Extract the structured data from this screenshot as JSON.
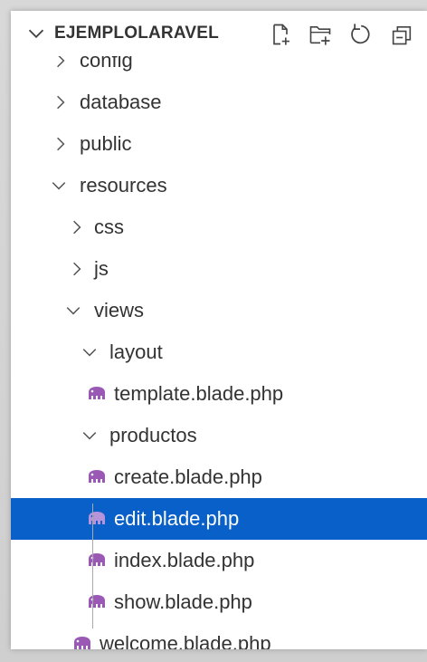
{
  "explorer": {
    "title": "EJEMPLOLARAVEL",
    "actions": {
      "new_file_icon": "new-file-icon",
      "new_folder_icon": "new-folder-icon",
      "refresh_icon": "refresh-icon",
      "collapse_icon": "collapse-all-icon"
    },
    "items": [
      {
        "label": "config",
        "type": "folder",
        "expanded": false,
        "depth": 0
      },
      {
        "label": "database",
        "type": "folder",
        "expanded": false,
        "depth": 0
      },
      {
        "label": "public",
        "type": "folder",
        "expanded": false,
        "depth": 0
      },
      {
        "label": "resources",
        "type": "folder",
        "expanded": true,
        "depth": 0
      },
      {
        "label": "css",
        "type": "folder",
        "expanded": false,
        "depth": 1
      },
      {
        "label": "js",
        "type": "folder",
        "expanded": false,
        "depth": 1
      },
      {
        "label": "views",
        "type": "folder",
        "expanded": true,
        "depth": 1
      },
      {
        "label": "layout",
        "type": "folder",
        "expanded": true,
        "depth": 2
      },
      {
        "label": "template.blade.php",
        "type": "file",
        "depth": 3
      },
      {
        "label": "productos",
        "type": "folder",
        "expanded": true,
        "depth": 2
      },
      {
        "label": "create.blade.php",
        "type": "file",
        "depth": 3
      },
      {
        "label": "edit.blade.php",
        "type": "file",
        "depth": 3,
        "selected": true
      },
      {
        "label": "index.blade.php",
        "type": "file",
        "depth": 3
      },
      {
        "label": "show.blade.php",
        "type": "file",
        "depth": 3
      },
      {
        "label": "welcome.blade.php",
        "type": "file",
        "depth": 2
      }
    ]
  },
  "colors": {
    "selection": "#0860c8",
    "text": "#333333",
    "blade_icon": "#9b59b6",
    "blade_icon_selected": "#b793d9"
  }
}
